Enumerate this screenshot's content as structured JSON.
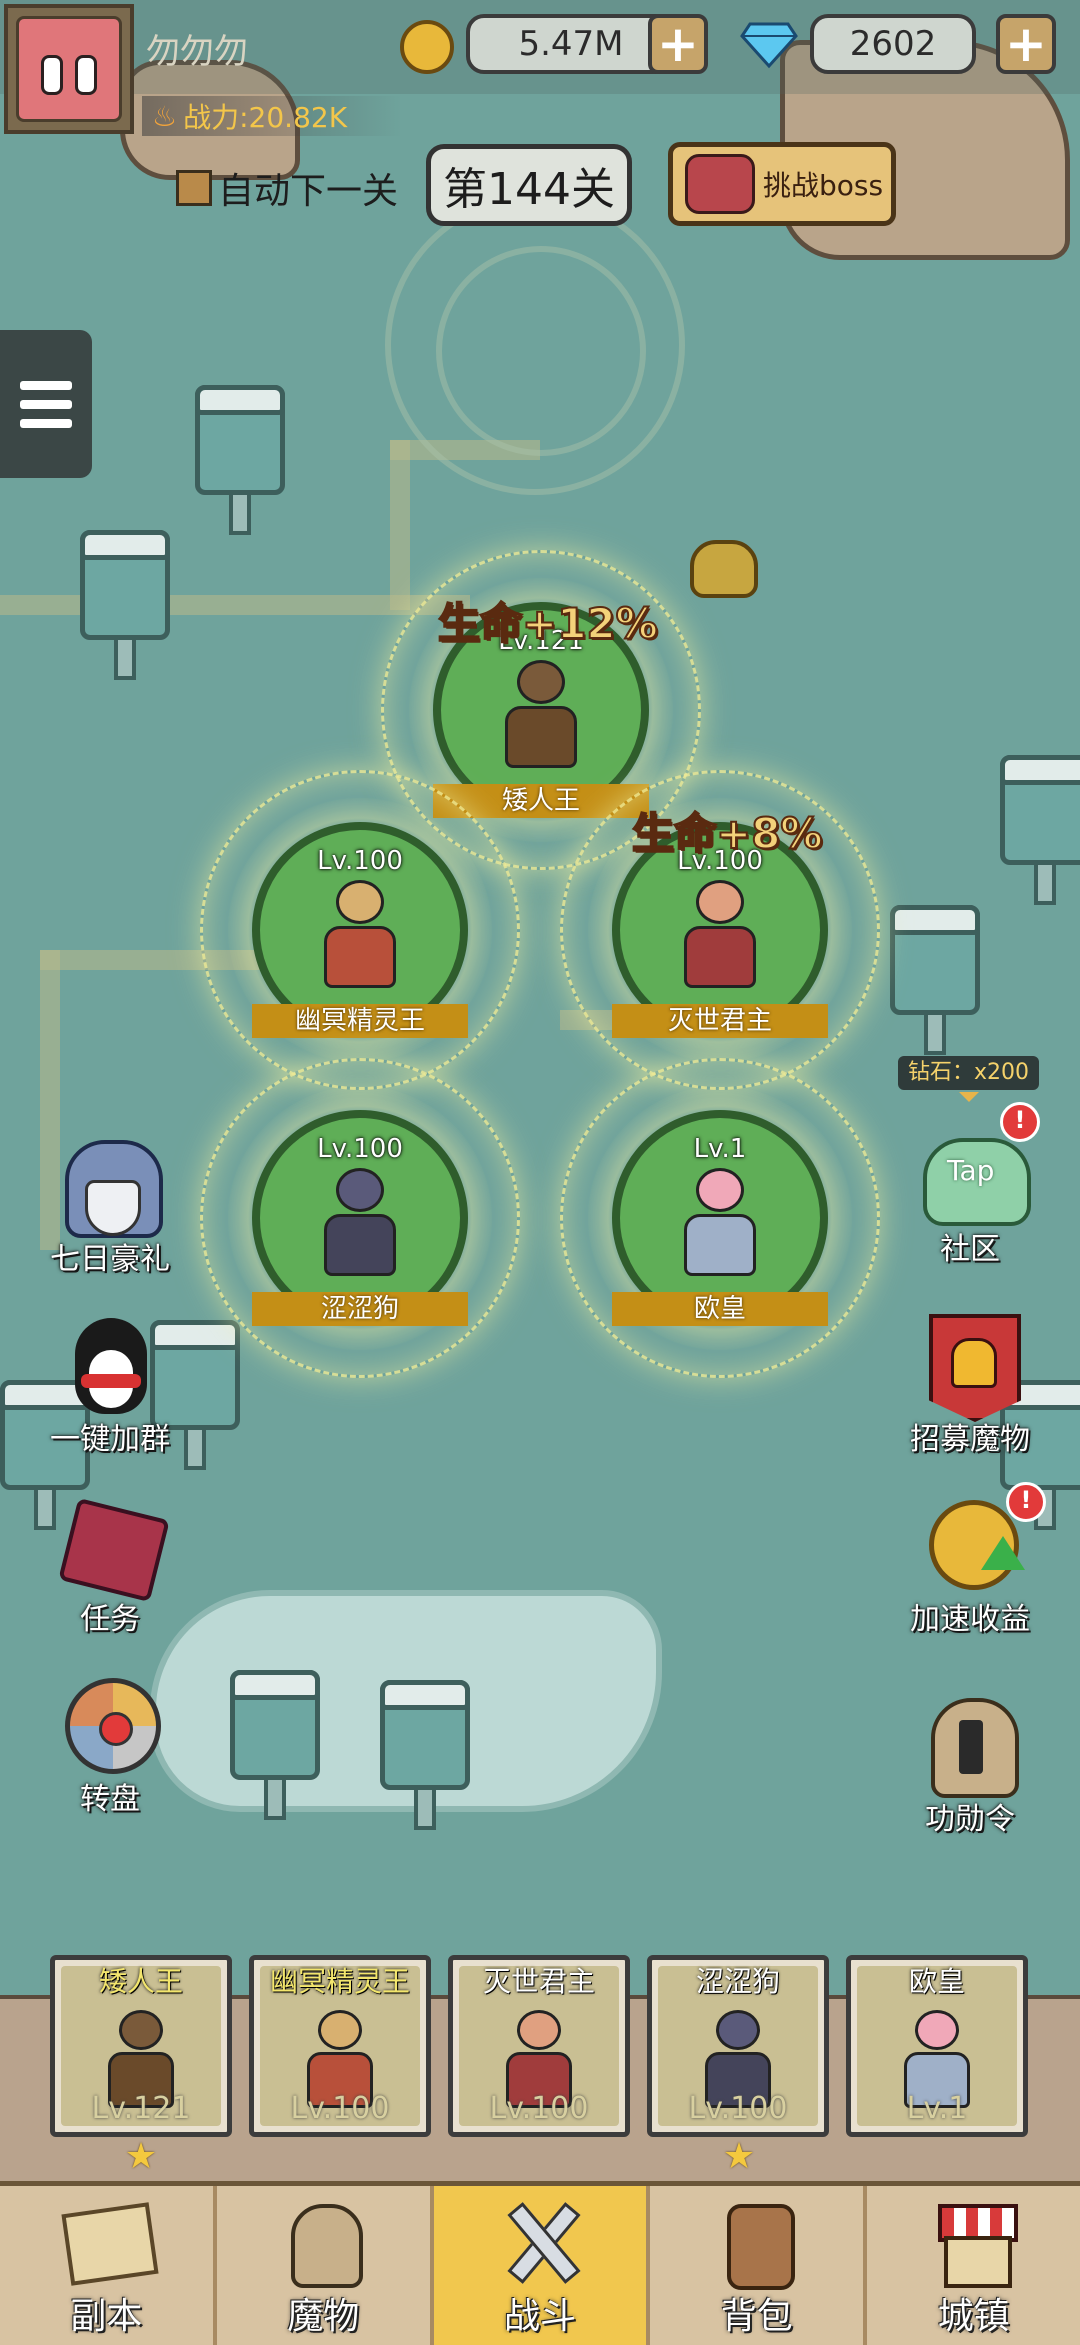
{
  "player": {
    "name": "勿勿勿",
    "power": "战力:20.82K",
    "gold": "5.47M",
    "diamonds": "2602"
  },
  "stage": {
    "auto_next_label": "自动下一关",
    "current": "第144关",
    "boss_label": "挑战boss"
  },
  "formation": [
    {
      "name": "矮人王",
      "level": "Lv.121",
      "bonus": "生命+12%",
      "color": "#7a5a3a"
    },
    {
      "name": "幽冥精灵王",
      "level": "Lv.100",
      "bonus": "",
      "color": "#b8503a"
    },
    {
      "name": "灭世君主",
      "level": "Lv.100",
      "bonus": "生命+8%",
      "color": "#a03c3c"
    },
    {
      "name": "涩涩狗",
      "level": "Lv.100",
      "bonus": "",
      "color": "#5a5a7a"
    },
    {
      "name": "欧皇",
      "level": "Lv.1",
      "bonus": "",
      "color": "#f0a8b8"
    }
  ],
  "left_menu": [
    {
      "label": "七日豪礼",
      "icon": "knight-helmet-icon"
    },
    {
      "label": "一键加群",
      "icon": "penguin-icon"
    },
    {
      "label": "任务",
      "icon": "quest-book-icon"
    },
    {
      "label": "转盘",
      "icon": "spin-wheel-icon"
    }
  ],
  "right_menu": [
    {
      "label": "社区",
      "icon": "taptap-icon",
      "tip": "钻石：x200",
      "badge": "!"
    },
    {
      "label": "招募魔物",
      "icon": "recruit-banner-icon"
    },
    {
      "label": "加速收益",
      "icon": "speedup-coin-icon",
      "badge": "!"
    },
    {
      "label": "功勋令",
      "icon": "merit-helmet-icon"
    }
  ],
  "lineup": [
    {
      "name": "矮人王",
      "level": "Lv.121",
      "star": true
    },
    {
      "name": "幽冥精灵王",
      "level": "Lv.100",
      "star": false
    },
    {
      "name": "灭世君主",
      "level": "Lv.100",
      "star": false
    },
    {
      "name": "涩涩狗",
      "level": "Lv.100",
      "star": true
    },
    {
      "name": "欧皇",
      "level": "Lv.1",
      "star": false
    }
  ],
  "bottom_nav": [
    {
      "label": "副本",
      "icon": "map-icon",
      "active": false
    },
    {
      "label": "魔物",
      "icon": "monster-helmet-icon",
      "active": false
    },
    {
      "label": "战斗",
      "icon": "crossed-swords-icon",
      "active": true
    },
    {
      "label": "背包",
      "icon": "backpack-icon",
      "active": false
    },
    {
      "label": "城镇",
      "icon": "shop-icon",
      "active": false
    }
  ],
  "colors": {
    "accent_gold": "#f1c74e",
    "slot_green": "#5fae57",
    "map_bg": "#6fa39c"
  }
}
